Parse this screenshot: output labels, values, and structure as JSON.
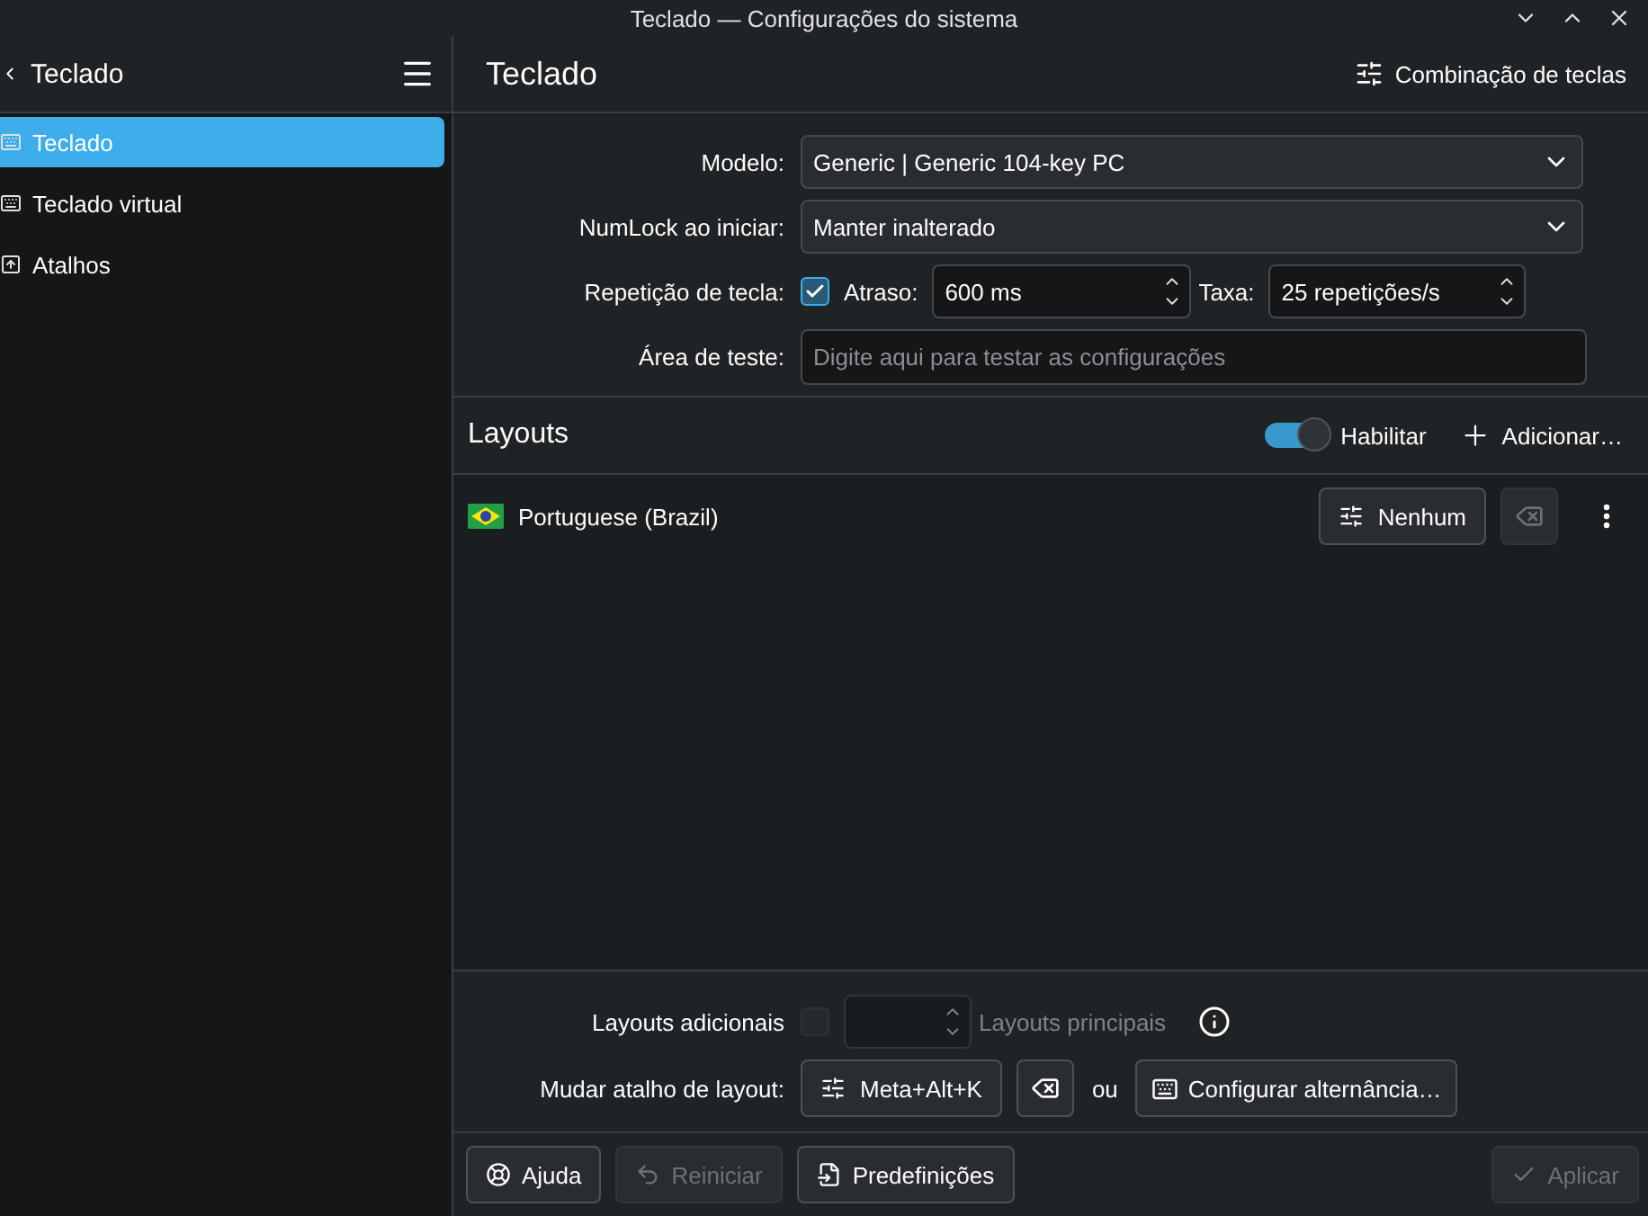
{
  "window": {
    "title": "Teclado — Configurações do sistema"
  },
  "sidebar": {
    "title": "Teclado",
    "items": [
      {
        "label": "Teclado",
        "kind": "keyboard",
        "selected": true
      },
      {
        "label": "Teclado virtual",
        "kind": "keyboard",
        "selected": false
      },
      {
        "label": "Atalhos",
        "kind": "key",
        "selected": false
      }
    ]
  },
  "page": {
    "title": "Teclado",
    "header_button": "Combinação de teclas"
  },
  "form": {
    "model": {
      "label": "Modelo:",
      "value": "Generic | Generic 104-key PC"
    },
    "numlock": {
      "label": "NumLock ao iniciar:",
      "value": "Manter inalterado"
    },
    "repeat": {
      "label": "Repetição de tecla:",
      "checked": true,
      "delay_label": "Atraso:",
      "delay_value": "600 ms",
      "rate_label": "Taxa:",
      "rate_value": "25 repetições/s"
    },
    "test": {
      "label": "Área de teste:",
      "placeholder": "Digite aqui para testar as configurações"
    }
  },
  "layouts": {
    "title": "Layouts",
    "toggle": {
      "label": "Habilitar",
      "on": true
    },
    "add_button": "Adicionar…",
    "rows": [
      {
        "name": "Portuguese (Brazil)",
        "shortcut": "Nenhum",
        "clear_disabled": true
      }
    ]
  },
  "options": {
    "extra": {
      "label": "Layouts adicionais",
      "checked": false,
      "disabled": true,
      "main_label": "Layouts principais"
    },
    "switch": {
      "label": "Mudar atalho de layout:",
      "shortcut": "Meta+Alt+K",
      "or": "ou",
      "configure": "Configurar alternância…"
    }
  },
  "footer": [
    {
      "label": "Ajuda",
      "kind": "help",
      "disabled": false
    },
    {
      "label": "Reiniciar",
      "kind": "reset",
      "disabled": true
    },
    {
      "label": "Predefinições",
      "kind": "defaults",
      "disabled": false
    },
    {
      "label": "Aplicar",
      "kind": "apply",
      "disabled": true
    }
  ]
}
